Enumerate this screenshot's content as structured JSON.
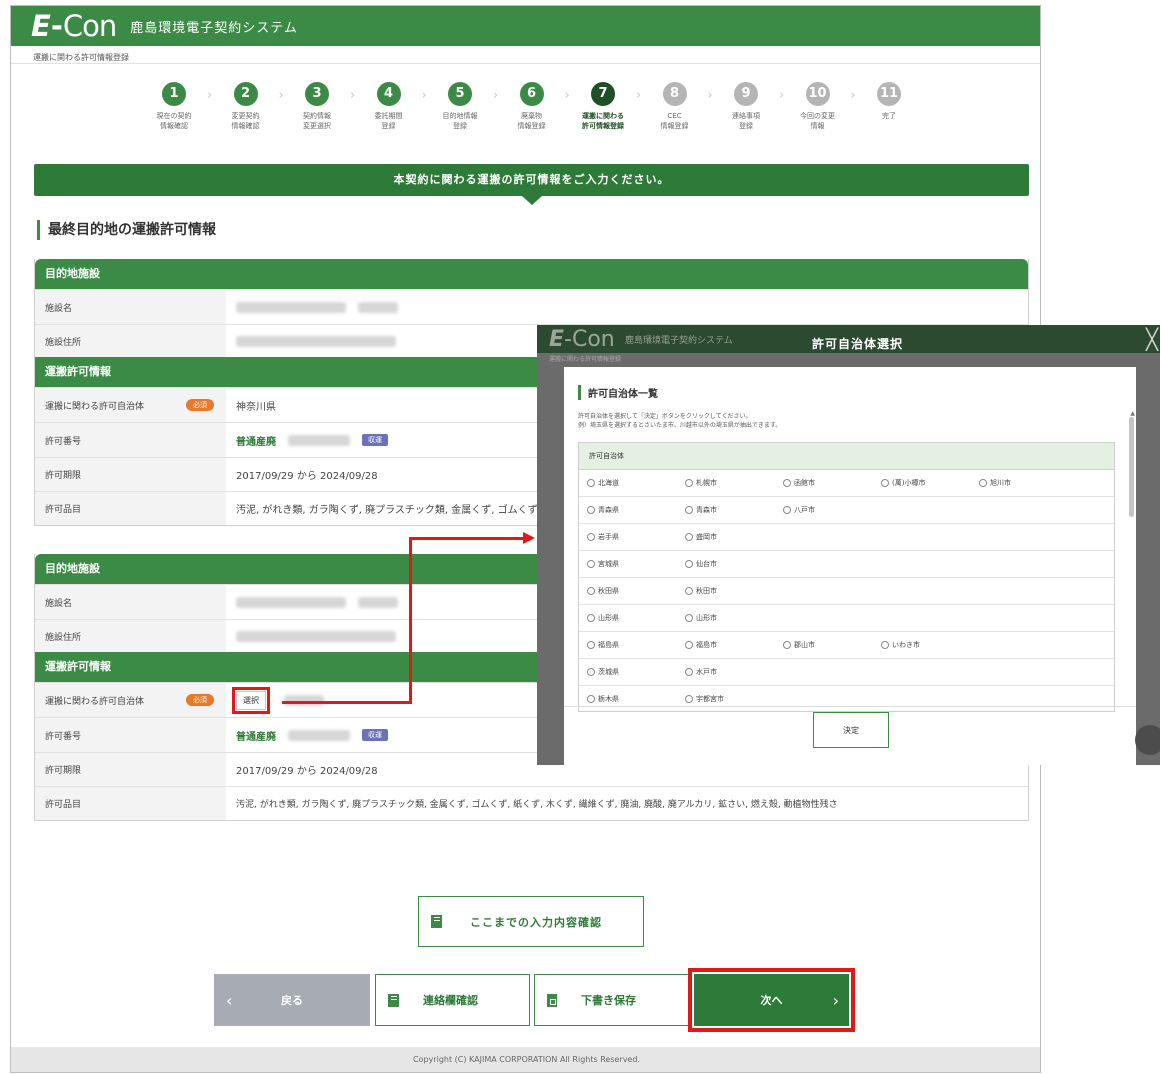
{
  "app": {
    "logo_e": "E",
    "logo_dash": "-",
    "logo_con": "Con",
    "title": "鹿島環境電子契約システム",
    "breadcrumb": "運搬に関わる許可情報登録"
  },
  "steps": [
    {
      "num": "1",
      "label": "現在の契約\n情報確認",
      "state": "done"
    },
    {
      "num": "2",
      "label": "変更契約\n情報確認",
      "state": "done"
    },
    {
      "num": "3",
      "label": "契約情報\n変更選択",
      "state": "done"
    },
    {
      "num": "4",
      "label": "委託期間\n登録",
      "state": "done"
    },
    {
      "num": "5",
      "label": "目的地情報\n登録",
      "state": "done"
    },
    {
      "num": "6",
      "label": "廃棄物\n情報登録",
      "state": "done"
    },
    {
      "num": "7",
      "label": "運搬に関わる\n許可情報登録",
      "state": "current"
    },
    {
      "num": "8",
      "label": "CEC\n情報登録",
      "state": "pending"
    },
    {
      "num": "9",
      "label": "連絡事項\n登録",
      "state": "pending"
    },
    {
      "num": "10",
      "label": "今回の変更\n情報",
      "state": "pending"
    },
    {
      "num": "11",
      "label": "完了",
      "state": "pending"
    }
  ],
  "banner": "本契約に関わる運搬の許可情報をご入力ください。",
  "section_title": "最終目的地の運搬許可情報",
  "card1": {
    "header": "目的地施設",
    "facility_name_label": "施設名",
    "facility_address_label": "施設住所",
    "permit_header": "運搬許可情報",
    "municipality_label": "運搬に関わる許可自治体",
    "required_badge": "必須",
    "municipality_value": "神奈川県",
    "permit_number_label": "許可番号",
    "permit_type": "普通産廃",
    "received_badge": "収運",
    "permit_period_label": "許可期限",
    "permit_period_value": "2017/09/29 から 2024/09/28",
    "permit_items_label": "許可品目",
    "permit_items_value": "汚泥, がれき類, ガラ陶くず, 廃プラスチック類, 金属くず, ゴムくず, 紙くず, 木くず,"
  },
  "card2": {
    "header": "目的地施設",
    "facility_name_label": "施設名",
    "facility_address_label": "施設住所",
    "permit_header": "運搬許可情報",
    "municipality_label": "運搬に関わる許可自治体",
    "required_badge": "必須",
    "select_button": "選択",
    "permit_number_label": "許可番号",
    "permit_type": "普通産廃",
    "received_badge": "収運",
    "permit_period_label": "許可期限",
    "permit_period_value": "2017/09/29 から 2024/09/28",
    "permit_items_label": "許可品目",
    "permit_items_value": "汚泥, がれき類, ガラ陶くず, 廃プラスチック類, 金属くず, ゴムくず, 紙くず, 木くず, 繊維くず, 廃油, 廃酸, 廃アルカリ, 鉱さい, 燃え殻, 動植物性残さ"
  },
  "buttons": {
    "confirm": "ここまでの入力内容確認",
    "back": "戻る",
    "contact": "連絡欄確認",
    "draft": "下書き保存",
    "next": "次へ"
  },
  "copyright": "Copyright (C) KAJIMA CORPORATION All Rights Reserved.",
  "modal": {
    "heading": "許可自治体選択",
    "panel_title": "許可自治体一覧",
    "desc_line1": "許可自治体を選択して「決定」ボタンをクリックしてください。",
    "desc_line2": "例）埼玉県を選択するとさいたま市、川越市以外の埼玉県が抽出できます。",
    "table_header": "許可自治体",
    "rows": [
      [
        "北海道",
        "札幌市",
        "函館市",
        "(萬)小樽市",
        "旭川市"
      ],
      [
        "青森県",
        "青森市",
        "八戸市"
      ],
      [
        "岩手県",
        "盛岡市"
      ],
      [
        "宮城県",
        "仙台市"
      ],
      [
        "秋田県",
        "秋田市"
      ],
      [
        "山形県",
        "山形市"
      ],
      [
        "福島県",
        "福島市",
        "郡山市",
        "いわき市"
      ],
      [
        "茨城県",
        "水戸市"
      ],
      [
        "栃木県",
        "宇都宮市"
      ]
    ],
    "decide_button": "決定"
  }
}
